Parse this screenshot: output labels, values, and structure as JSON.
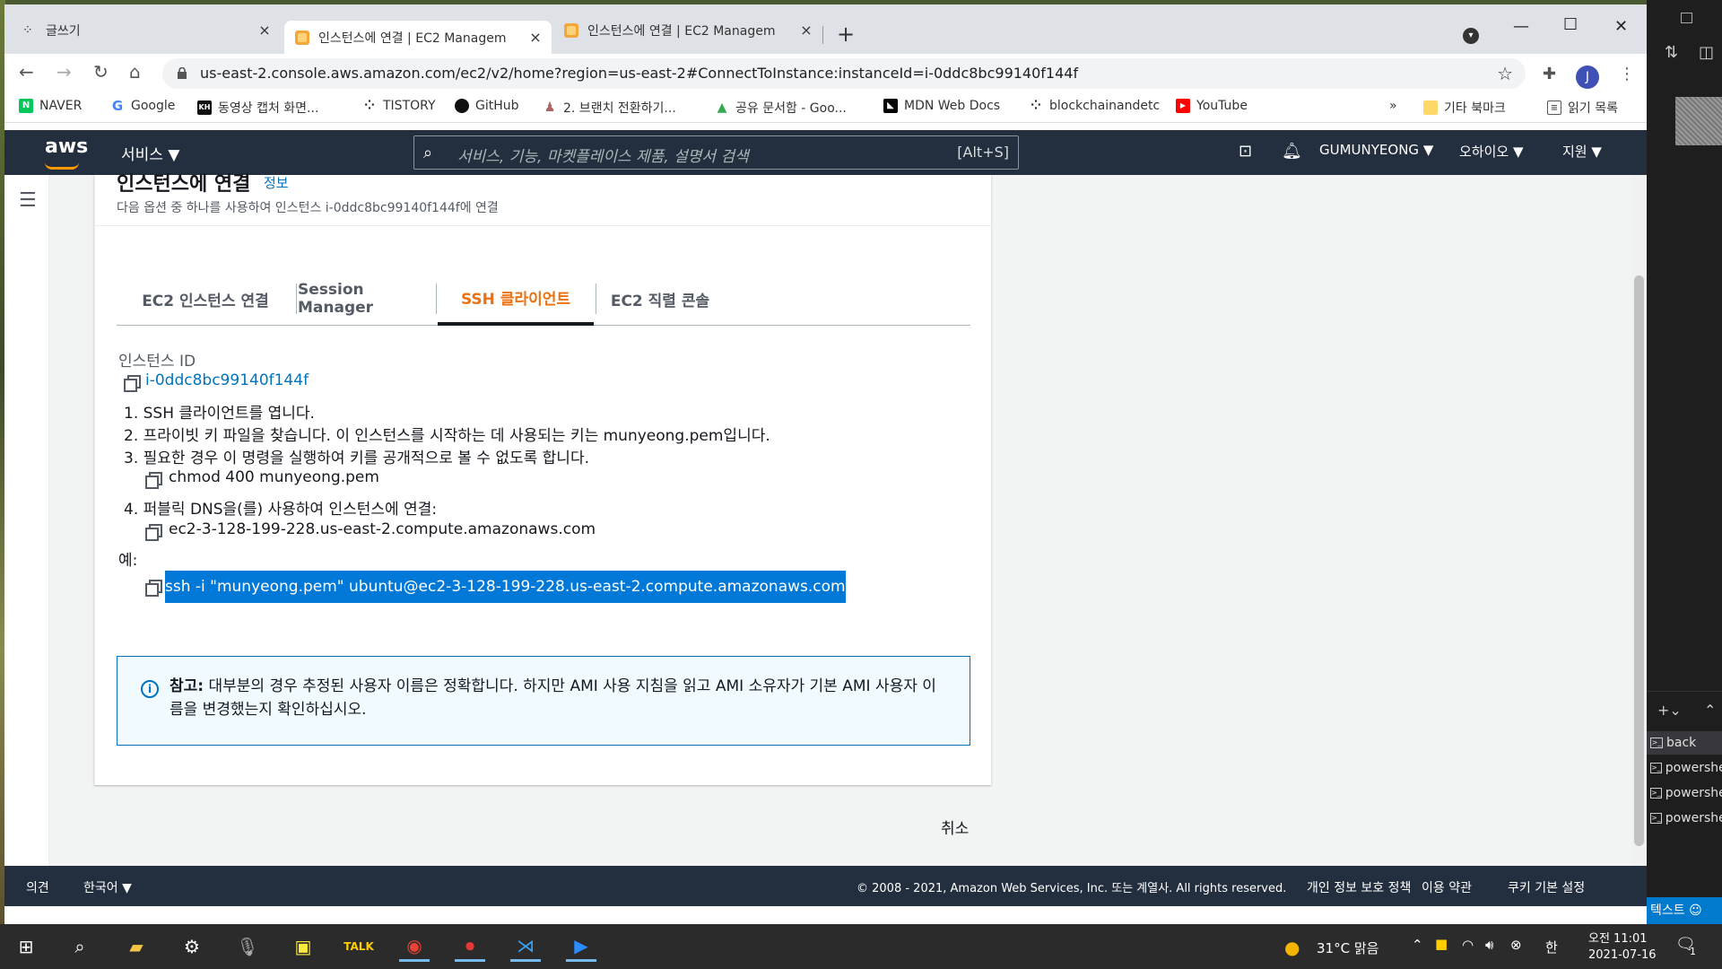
{
  "browser": {
    "tabs": [
      {
        "title": "글쓰기",
        "close": "×"
      },
      {
        "title": "인스턴스에 연결 | EC2 Managem",
        "close": "×"
      },
      {
        "title": "인스턴스에 연결 | EC2 Managem",
        "close": "×"
      }
    ],
    "new_tab": "+",
    "url": "us-east-2.console.aws.amazon.com/ec2/v2/home?region=us-east-2#ConnectToInstance:instanceId=i-0ddc8bc99140f144f",
    "avatar_letter": "J",
    "bookmarks": [
      {
        "label": "NAVER",
        "icon": "naver-icon",
        "color": "#03c75a",
        "glyph": "N"
      },
      {
        "label": "Google",
        "icon": "google-icon",
        "color": "#4285f4",
        "glyph": "G"
      },
      {
        "label": "동영상 캡처 화면...",
        "icon": "kh-icon",
        "color": "#111111",
        "glyph": "K"
      },
      {
        "label": "TISTORY",
        "icon": "tistory-icon",
        "color": "#222222",
        "glyph": "⁘"
      },
      {
        "label": "GitHub",
        "icon": "github-icon",
        "color": "#111111",
        "glyph": "●"
      },
      {
        "label": "2. 브랜치 전환하기...",
        "icon": "branch-icon",
        "color": "#c96",
        "glyph": "♟"
      },
      {
        "label": "공유 문서함 - Goo...",
        "icon": "gdrive-icon",
        "color": "#34a853",
        "glyph": "▲"
      },
      {
        "label": "MDN Web Docs",
        "icon": "mdn-icon",
        "color": "#000000",
        "glyph": "◣"
      },
      {
        "label": "blockchainandetc",
        "icon": "blog-icon",
        "color": "#222222",
        "glyph": "⁘"
      },
      {
        "label": "YouTube",
        "icon": "youtube-icon",
        "color": "#ff0000",
        "glyph": "▶"
      }
    ],
    "bookmarks_more": "»",
    "other_bookmarks": "기타 북마크",
    "reading_list": "읽기 목록"
  },
  "aws": {
    "logo": "aws",
    "services": "서비스",
    "search_placeholder": "서비스, 기능, 마켓플레이스 제품, 설명서 검색",
    "search_shortcut": "[Alt+S]",
    "account": "GUMUNYEONG",
    "region": "오하이오",
    "support": "지원"
  },
  "panel": {
    "title": "인스턴스에 연결",
    "info": "정보",
    "subtitle": "다음 옵션 중 하나를 사용하여 인스턴스 i-0ddc8bc99140f144f에 연결",
    "tabs": [
      "EC2 인스턴스 연결",
      "Session Manager",
      "SSH 클라이언트",
      "EC2 직렬 콘솔"
    ],
    "instance_id_label": "인스턴스 ID",
    "instance_id": "i-0ddc8bc99140f144f",
    "steps": [
      "1. SSH 클라이언트를 엽니다.",
      "2. 프라이빗 키 파일을 찾습니다. 이 인스턴스를 시작하는 데 사용되는 키는 munyeong.pem입니다.",
      "3. 필요한 경우 이 명령을 실행하여 키를 공개적으로 볼 수 없도록 합니다.",
      "4. 퍼블릭 DNS을(를) 사용하여 인스턴스에 연결:"
    ],
    "chmod_cmd": "chmod 400 munyeong.pem",
    "public_dns": "ec2-3-128-199-228.us-east-2.compute.amazonaws.com",
    "example_label": "예:",
    "ssh_cmd": "ssh -i \"munyeong.pem\" ubuntu@ec2-3-128-199-228.us-east-2.compute.amazonaws.com",
    "note_bold": "참고:",
    "note_text": " 대부분의 경우 추정된 사용자 이름은 정확합니다. 하지만 AMI 사용 지침을 읽고 AMI 소유자가 기본 AMI 사용자 이름을 변경했는지 확인하십시오.",
    "cancel": "취소"
  },
  "footer": {
    "feedback": "의견",
    "language": "한국어",
    "copyright": "© 2008 - 2021, Amazon Web Services, Inc. 또는 계열사. All rights reserved.",
    "privacy": "개인 정보 보호 정책",
    "terms": "이용 약관",
    "cookies": "쿠키 기본 설정"
  },
  "side_app": {
    "terminals": [
      "back",
      "powershell",
      "powershell",
      "powershell"
    ],
    "status": "텍스트"
  },
  "taskbar": {
    "weather": "31°C 맑음",
    "ime": "한",
    "time": "오전 11:01",
    "date": "2021-07-16",
    "notifications": "1"
  },
  "colors": {
    "aws_nav": "#232f3e",
    "aws_orange": "#ec7211",
    "link": "#0073bb",
    "selection": "#0078d7"
  }
}
